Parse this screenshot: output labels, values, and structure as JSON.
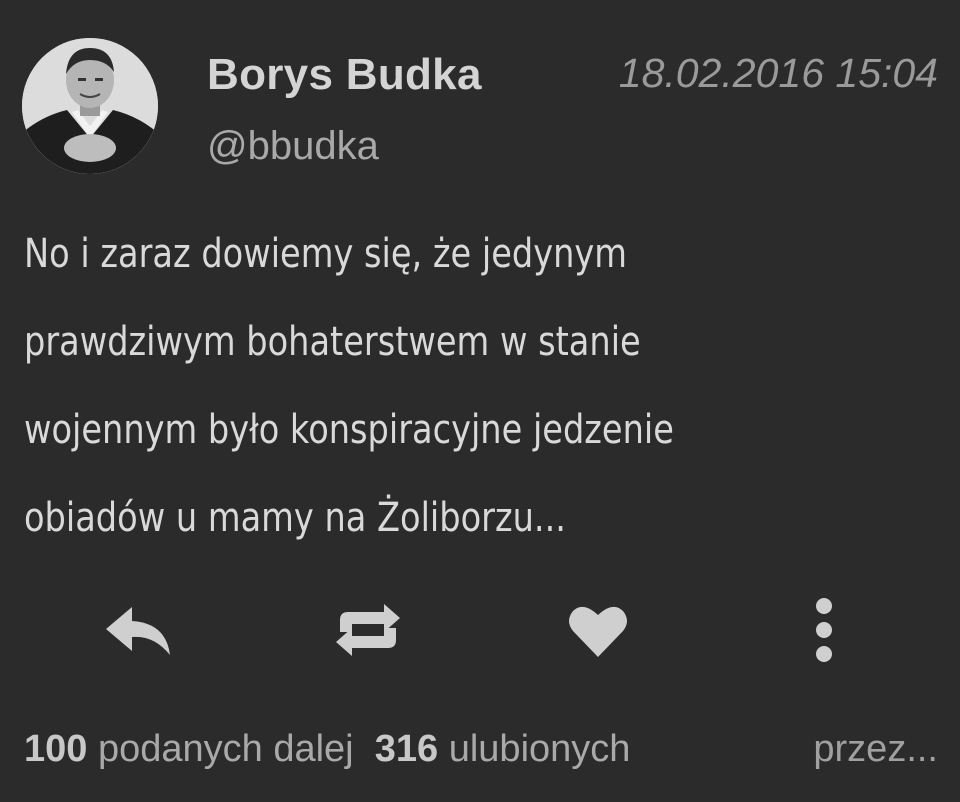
{
  "author": {
    "name": "Borys Budka",
    "handle": "@bbudka"
  },
  "timestamp": "18.02.2016 15:04",
  "tweet": {
    "lines": [
      "No i zaraz dowiemy się, że jedynym",
      "prawdziwym bohaterstwem w stanie",
      "wojennym było konspiracyjne jedzenie",
      "obiadów u mamy na Żoliborzu..."
    ]
  },
  "actions": {
    "reply_icon": "reply-icon",
    "retweet_icon": "retweet-icon",
    "like_icon": "heart-icon",
    "more_icon": "more-vertical-icon"
  },
  "stats": {
    "retweets_count": "100",
    "retweets_label": "podanych dalej",
    "likes_count": "316",
    "likes_label": "ulubionych",
    "via": "przez..."
  }
}
